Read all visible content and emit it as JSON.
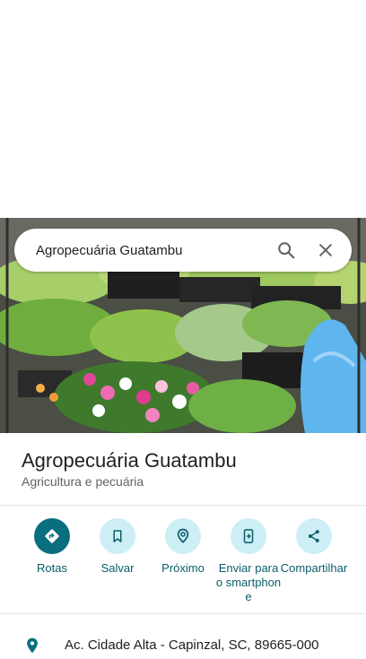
{
  "search": {
    "query": "Agropecuária Guatambu"
  },
  "place": {
    "name": "Agropecuária Guatambu",
    "category": "Agricultura e pecuária",
    "address": "Ac. Cidade Alta - Capinzal, SC, 89665-000"
  },
  "actions": [
    {
      "label": "Rotas",
      "icon": "directions-icon"
    },
    {
      "label": "Salvar",
      "icon": "bookmark-icon"
    },
    {
      "label": "Próximo",
      "icon": "nearby-icon"
    },
    {
      "label": "Enviar para o smartphone",
      "icon": "send-to-phone-icon"
    },
    {
      "label": "Compartilhar",
      "icon": "share-icon"
    }
  ],
  "colors": {
    "accent": "#0b6e7f",
    "accent_light": "#cdeef5",
    "label": "#0b5d6b"
  }
}
